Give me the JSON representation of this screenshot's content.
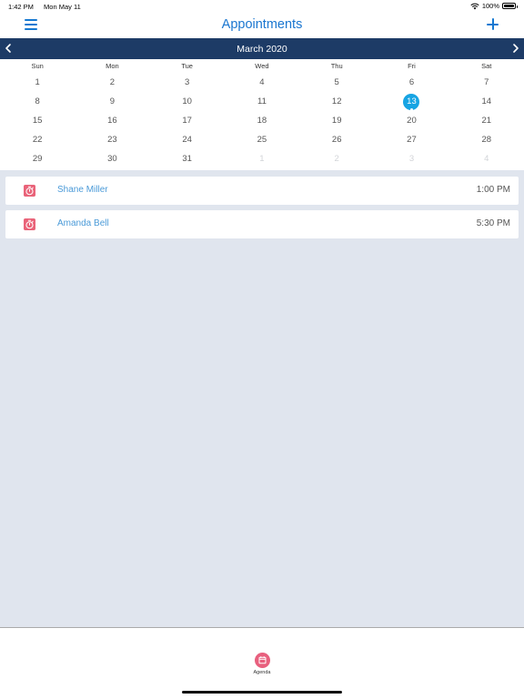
{
  "status": {
    "time": "1:42 PM",
    "date": "Mon May 11",
    "battery": "100%"
  },
  "nav": {
    "title": "Appointments",
    "menu_icon": "hamburger-menu-icon",
    "add_icon": "plus-icon"
  },
  "calendar": {
    "month": "March 2020",
    "weekdays": [
      "Sun",
      "Mon",
      "Tue",
      "Wed",
      "Thu",
      "Fri",
      "Sat"
    ],
    "weeks": [
      [
        "1",
        "2",
        "3",
        "4",
        "5",
        "6",
        "7"
      ],
      [
        "8",
        "9",
        "10",
        "11",
        "12",
        "13",
        "14"
      ],
      [
        "15",
        "16",
        "17",
        "18",
        "19",
        "20",
        "21"
      ],
      [
        "22",
        "23",
        "24",
        "25",
        "26",
        "27",
        "28"
      ],
      [
        "29",
        "30",
        "31",
        "1",
        "2",
        "3",
        "4"
      ]
    ],
    "selected_day": "13",
    "selected_color": "#17a4e3",
    "header_color": "#1d3b66"
  },
  "appointments": [
    {
      "name": "Shane Miller",
      "time": "1:00 PM",
      "icon": "stopwatch-icon"
    },
    {
      "name": "Amanda Bell",
      "time": "5:30 PM",
      "icon": "stopwatch-icon"
    }
  ],
  "tabbar": {
    "label": "Agenda",
    "icon": "calendar-icon",
    "accent": "#e8607e"
  }
}
